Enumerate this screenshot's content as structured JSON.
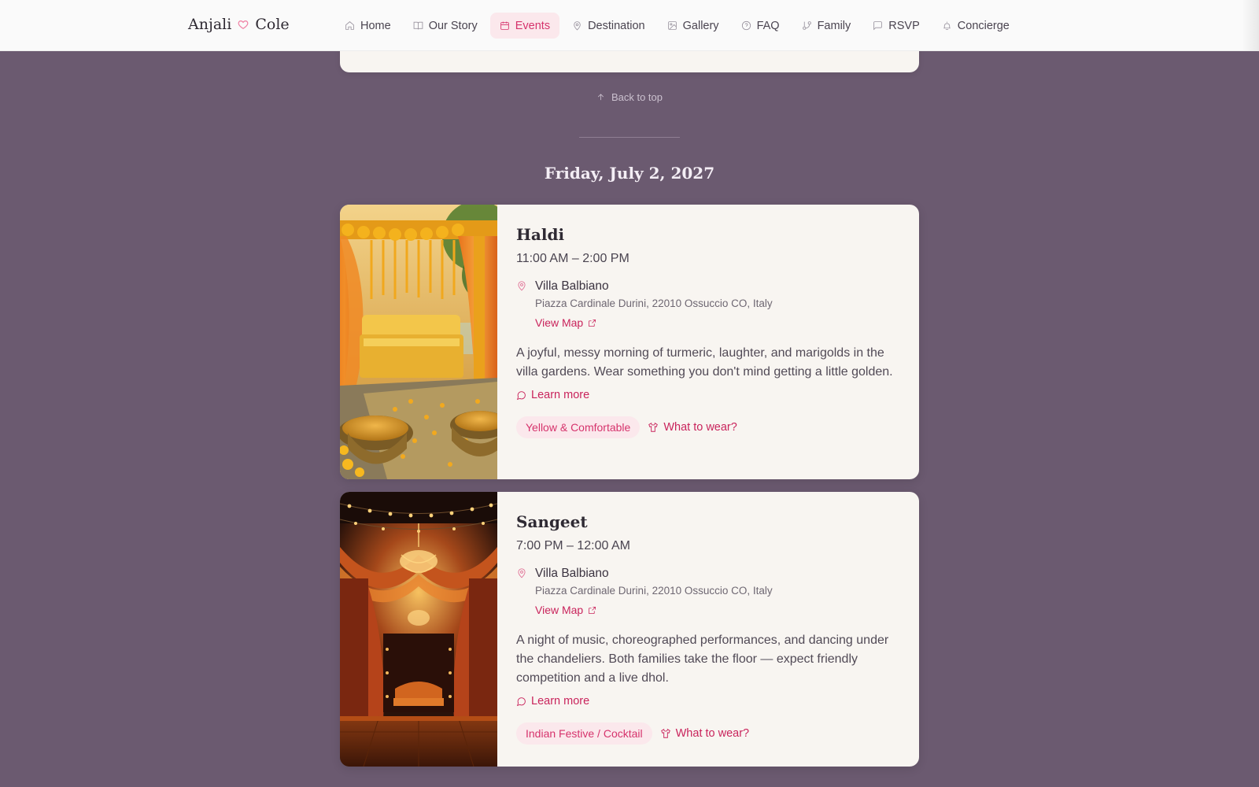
{
  "brand": {
    "first": "Anjali",
    "second": "Cole",
    "heart_icon": "heart-icon"
  },
  "nav": {
    "items": [
      {
        "label": "Home",
        "icon": "home-icon",
        "active": false
      },
      {
        "label": "Our Story",
        "icon": "book-icon",
        "active": false
      },
      {
        "label": "Events",
        "icon": "calendar-icon",
        "active": true
      },
      {
        "label": "Destination",
        "icon": "map-pin-icon",
        "active": false
      },
      {
        "label": "Gallery",
        "icon": "image-icon",
        "active": false
      },
      {
        "label": "FAQ",
        "icon": "help-circle-icon",
        "active": false
      },
      {
        "label": "Family",
        "icon": "git-branch-icon",
        "active": false
      },
      {
        "label": "RSVP",
        "icon": "message-square-icon",
        "active": false
      },
      {
        "label": "Concierge",
        "icon": "bell-icon",
        "active": false
      }
    ]
  },
  "back_to_top": "Back to top",
  "day": {
    "heading": "Friday, July 2, 2027"
  },
  "events": [
    {
      "title": "Haldi",
      "time": "11:00 AM – 2:00 PM",
      "venue": "Villa Balbiano",
      "address": "Piazza Cardinale Durini, 22010 Ossuccio CO, Italy",
      "view_map": "View Map",
      "description": "A joyful, messy morning of turmeric, laughter, and marigolds in the villa gardens. Wear something you don't mind getting a little golden.",
      "learn_more": "Learn more",
      "dress_code": "Yellow & Comfortable",
      "what_to_wear": "What to wear?"
    },
    {
      "title": "Sangeet",
      "time": "7:00 PM – 12:00 AM",
      "venue": "Villa Balbiano",
      "address": "Piazza Cardinale Durini, 22010 Ossuccio CO, Italy",
      "view_map": "View Map",
      "description": "A night of music, choreographed performances, and dancing under the chandeliers. Both families take the floor — expect friendly competition and a live dhol.",
      "learn_more": "Learn more",
      "dress_code": "Indian Festive / Cocktail",
      "what_to_wear": "What to wear?"
    }
  ],
  "colors": {
    "page_bg": "#6b5a70",
    "card_bg": "#f8f5f1",
    "accent": "#d6336c",
    "accent_soft": "#fbe8ec"
  }
}
